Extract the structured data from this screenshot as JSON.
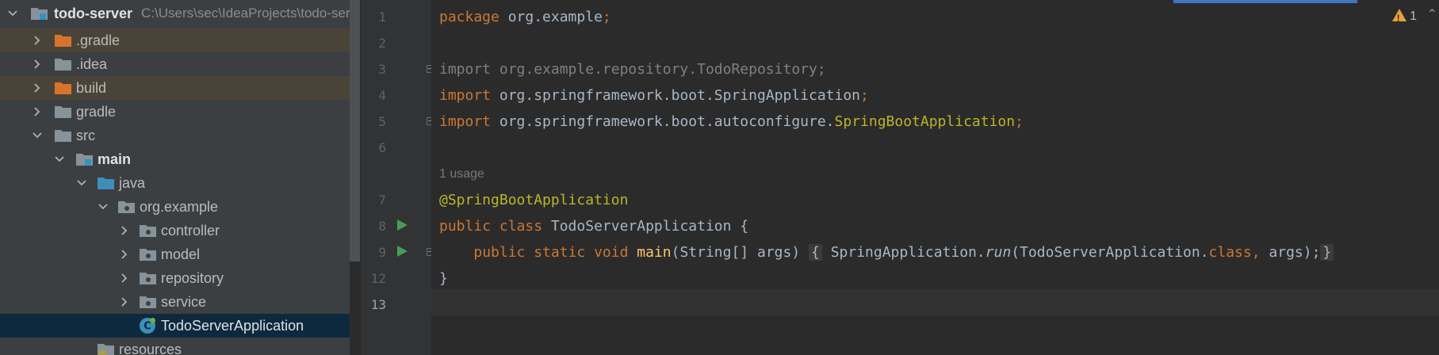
{
  "project_tree": {
    "root": {
      "name": "todo-server",
      "path": "C:\\Users\\sec\\IdeaProjects\\todo-server"
    },
    "items": [
      {
        "label": ".gradle",
        "kind": "excluded-folder"
      },
      {
        "label": ".idea",
        "kind": "folder"
      },
      {
        "label": "build",
        "kind": "excluded-folder"
      },
      {
        "label": "gradle",
        "kind": "folder"
      },
      {
        "label": "src",
        "kind": "folder"
      },
      {
        "label": "main",
        "kind": "module-folder"
      },
      {
        "label": "java",
        "kind": "source-root"
      },
      {
        "label": "org.example",
        "kind": "package"
      },
      {
        "label": "controller",
        "kind": "package"
      },
      {
        "label": "model",
        "kind": "package"
      },
      {
        "label": "repository",
        "kind": "package"
      },
      {
        "label": "service",
        "kind": "package"
      },
      {
        "label": "TodoServerApplication",
        "kind": "spring-boot-class"
      },
      {
        "label": "resources",
        "kind": "resources-folder"
      }
    ]
  },
  "editor": {
    "line_numbers": [
      "1",
      "2",
      "3",
      "4",
      "5",
      "6",
      "7",
      "8",
      "9",
      "12",
      "13"
    ],
    "usage_hint": "1 usage",
    "code": {
      "l1": {
        "kw": "package",
        "rest": " org.example",
        "semi": ";"
      },
      "l3": "import org.example.repository.TodoRepository;",
      "l4": {
        "kw": "import",
        "rest": " org.springframework.boot.SpringApplication",
        "semi": ";"
      },
      "l5": {
        "kw": "import",
        "rest": " org.springframework.boot.autoconfigure.",
        "cls": "SpringBootApplication",
        "semi": ";"
      },
      "l7": "@SpringBootApplication",
      "l8": {
        "kw": "public class",
        "rest": " TodoServerApplication {"
      },
      "l9": {
        "indent": "    ",
        "kw": "public static void",
        "method": " main",
        "params": "(String[] args) ",
        "open": "{",
        "call_start": " SpringApplication.",
        "run": "run",
        "call_args": "(TodoServerApplication.",
        "class_kw": "class",
        "comma": ",",
        "tail": " args);",
        "close": "}"
      },
      "l12": "}"
    },
    "warnings_count": "1",
    "colors": {
      "keyword": "#cc7832",
      "annotation": "#bbb529",
      "default": "#a9b7c6",
      "unused_import": "#808080",
      "run_gutter": "#499c54",
      "excluded_folder": "#d6742e"
    }
  }
}
